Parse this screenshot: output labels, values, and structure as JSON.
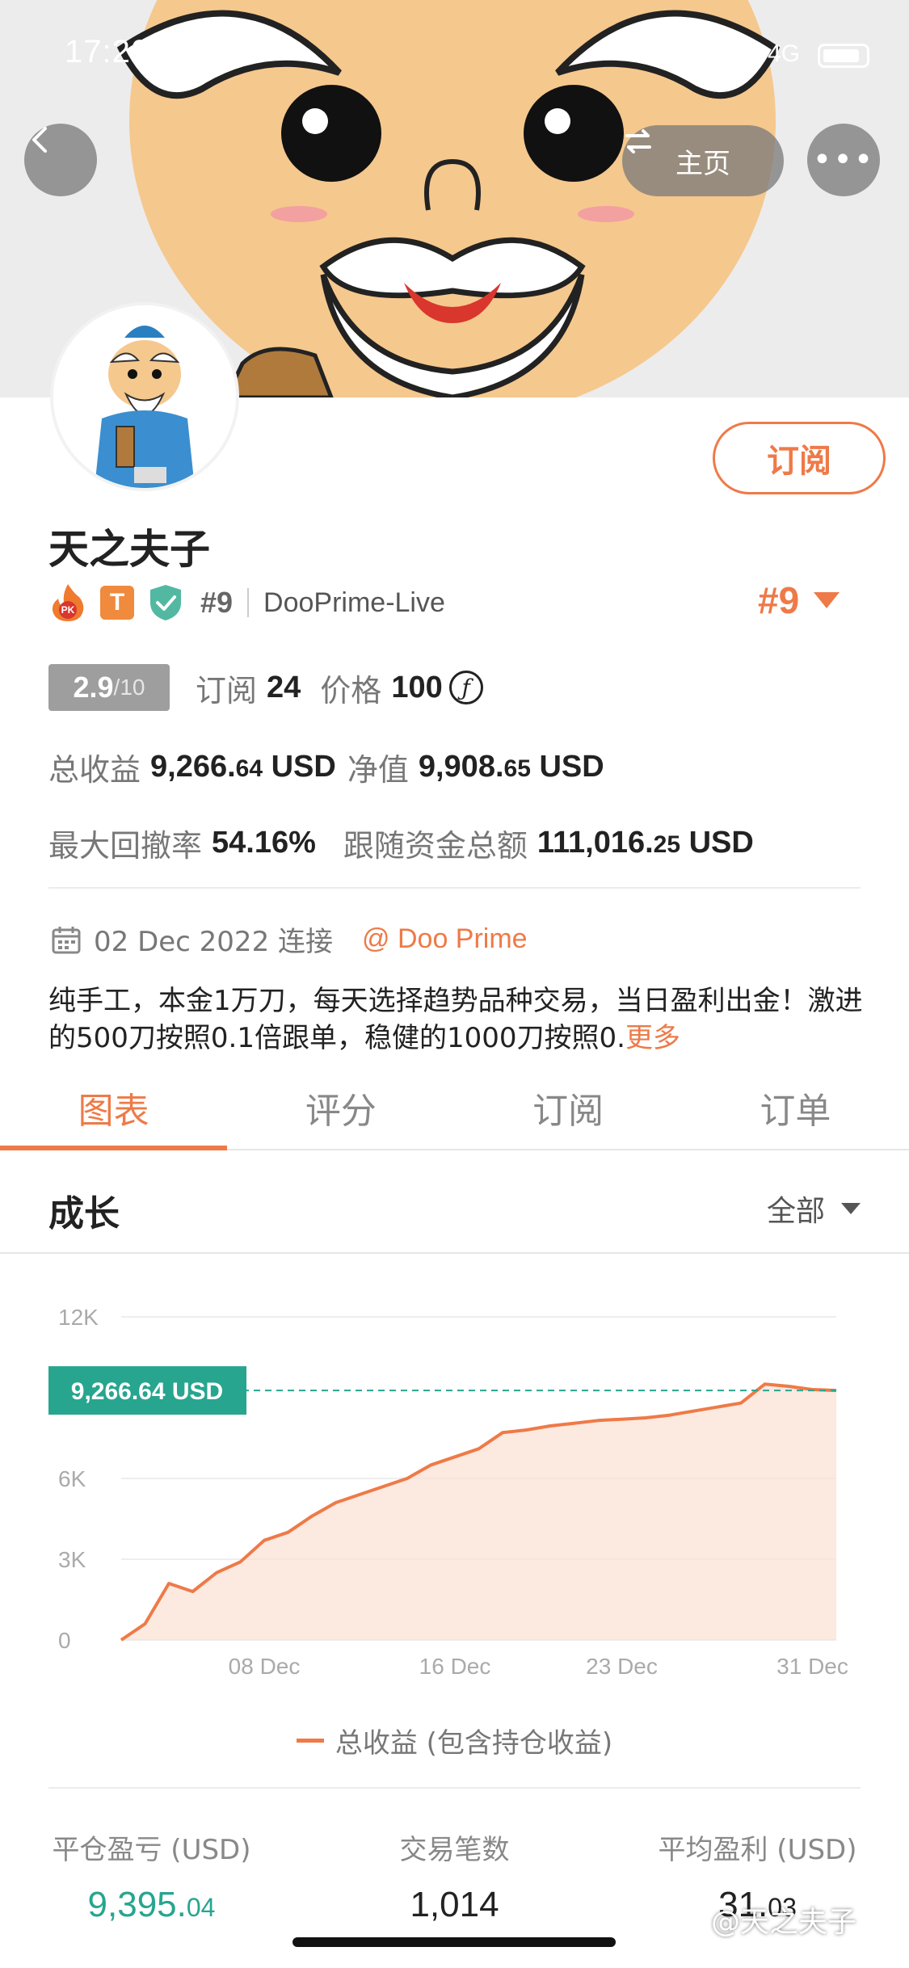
{
  "status_bar": {
    "time": "17:20",
    "network": "4G"
  },
  "nav": {
    "home_label": "主页",
    "more_label": "•••"
  },
  "profile": {
    "subscribe_label": "订阅",
    "username": "天之夫子",
    "badge_t": "T",
    "rank_small": "#9",
    "broker": "DooPrime-Live",
    "rank_big": "#9"
  },
  "stats": {
    "score": "2.9",
    "score_denominator": "/10",
    "subscribe_label": "订阅",
    "subscribe_count": "24",
    "price_label": "价格",
    "price_value": "100",
    "coin_symbol": "ƒ",
    "total_profit_label": "总收益",
    "total_profit_int": "9,266.",
    "total_profit_dec": "64",
    "total_profit_unit": "USD",
    "net_value_label": "净值",
    "net_value_int": "9,908.",
    "net_value_dec": "65",
    "net_value_unit": "USD",
    "max_drawdown_label": "最大回撤率",
    "max_drawdown_value": "54.16%",
    "follow_funds_label": "跟随资金总额",
    "follow_funds_int": "111,016.",
    "follow_funds_dec": "25",
    "follow_funds_unit": "USD"
  },
  "connection": {
    "date_text": "02 Dec 2022 连接",
    "broker_link": "@ Doo Prime"
  },
  "description": {
    "text": "纯手工，本金1万刀，每天选择趋势品种交易，当日盈利出金！激进的500刀按照0.1倍跟单，稳健的1000刀按照0.",
    "more_label": "更多"
  },
  "tabs": [
    {
      "label": "图表",
      "active": true
    },
    {
      "label": "评分",
      "active": false
    },
    {
      "label": "订阅",
      "active": false
    },
    {
      "label": "订单",
      "active": false
    }
  ],
  "section": {
    "title": "成长",
    "filter_label": "全部"
  },
  "chart_data": {
    "type": "area",
    "y_ticks": [
      "0",
      "3K",
      "6K",
      "12K"
    ],
    "x_tick_labels": [
      "08 Dec",
      "16 Dec",
      "23 Dec",
      "31 Dec"
    ],
    "ylim": [
      0,
      12000
    ],
    "current_value_label": "9,266.64 USD",
    "current_value": 9266.64,
    "series": [
      {
        "name": "总收益 (包含持仓收益)",
        "x": [
          "02 Dec",
          "03 Dec",
          "04 Dec",
          "05 Dec",
          "06 Dec",
          "07 Dec",
          "08 Dec",
          "09 Dec",
          "10 Dec",
          "11 Dec",
          "12 Dec",
          "13 Dec",
          "14 Dec",
          "15 Dec",
          "16 Dec",
          "17 Dec",
          "18 Dec",
          "19 Dec",
          "20 Dec",
          "21 Dec",
          "22 Dec",
          "23 Dec",
          "24 Dec",
          "25 Dec",
          "26 Dec",
          "27 Dec",
          "28 Dec",
          "29 Dec",
          "30 Dec",
          "31 Dec",
          "01 Jan"
        ],
        "values": [
          0,
          600,
          2100,
          1800,
          2500,
          2900,
          3700,
          4000,
          4600,
          5100,
          5400,
          5700,
          6000,
          6500,
          6800,
          7100,
          7700,
          7800,
          7950,
          8050,
          8150,
          8200,
          8250,
          8350,
          8500,
          8650,
          8800,
          9500,
          9420,
          9300,
          9266.64
        ]
      }
    ],
    "colors": {
      "line": "#ee7a48",
      "fill": "#fbe0d3",
      "marker": "#27a58f",
      "grid": "#eeeeee"
    }
  },
  "summary": [
    {
      "label": "平仓盈亏 (USD)",
      "value_int": "9,395.",
      "value_dec": "04",
      "color": "green"
    },
    {
      "label": "交易笔数",
      "value_int": "1,014",
      "value_dec": "",
      "color": "dark"
    },
    {
      "label": "平均盈利 (USD)",
      "value_int": "31.",
      "value_dec": "03",
      "color": "dark"
    }
  ],
  "watermark": "@天之夫子"
}
